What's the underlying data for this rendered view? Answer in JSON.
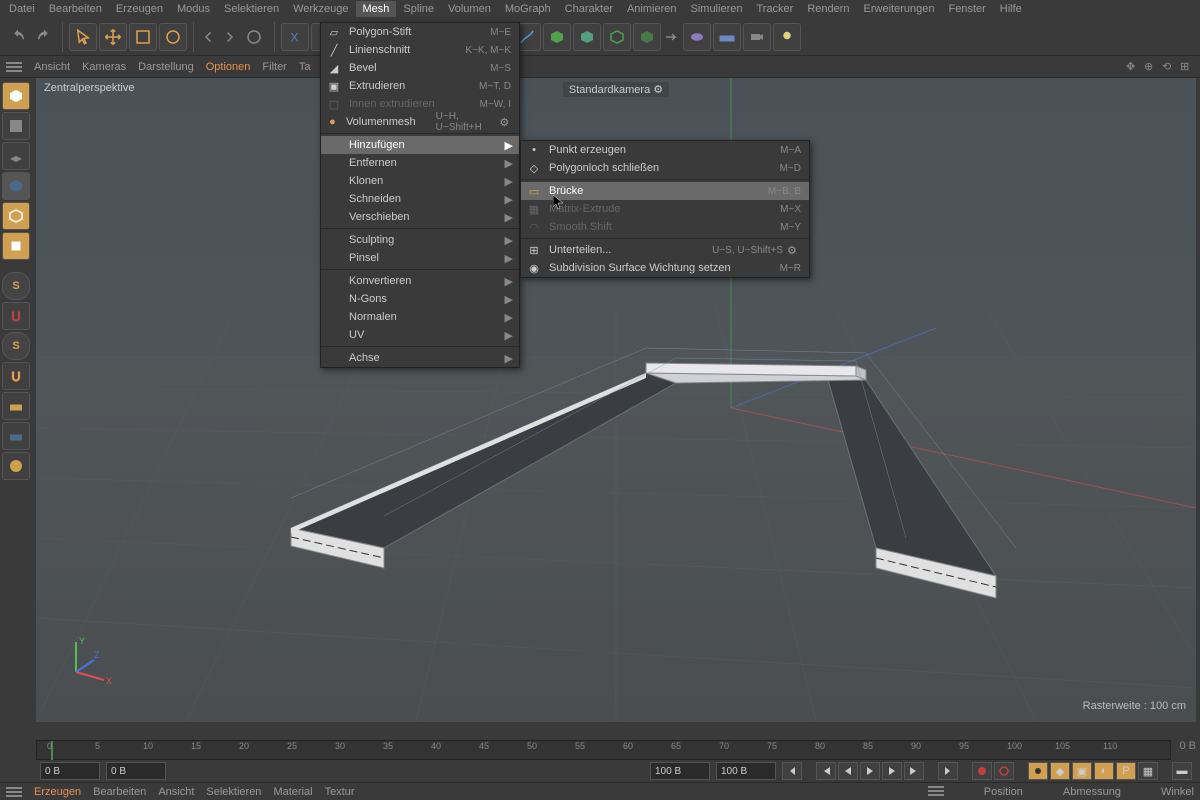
{
  "menubar": {
    "items": [
      "Datei",
      "Bearbeiten",
      "Erzeugen",
      "Modus",
      "Selektieren",
      "Werkzeuge",
      "Mesh",
      "Spline",
      "Volumen",
      "MoGraph",
      "Charakter",
      "Animieren",
      "Simulieren",
      "Tracker",
      "Rendern",
      "Erweiterungen",
      "Fenster",
      "Hilfe"
    ],
    "active_index": 6
  },
  "viewport_header": {
    "items": [
      "Ansicht",
      "Kameras",
      "Darstellung",
      "Optionen",
      "Filter",
      "Ta"
    ],
    "active_index": 3
  },
  "viewport": {
    "label": "Zentralperspektive",
    "camera": "Standardkamera",
    "grid_info": "Rasterweite : 100 cm"
  },
  "mesh_menu": {
    "items": [
      {
        "label": "Polygon-Stift",
        "shortcut": "M~E",
        "icon": "polygon"
      },
      {
        "label": "Linienschnitt",
        "shortcut": "K~K, M~K",
        "icon": "line"
      },
      {
        "label": "Bevel",
        "shortcut": "M~S",
        "icon": "bevel"
      },
      {
        "label": "Extrudieren",
        "shortcut": "M~T, D",
        "icon": "extrude"
      },
      {
        "label": "Innen extrudieren",
        "shortcut": "M~W, I",
        "icon": "inner",
        "disabled": true
      },
      {
        "label": "Volumenmesh",
        "shortcut": "U~H, U~Shift+H",
        "icon": "volume",
        "gear": true
      }
    ],
    "sep1": true,
    "items2": [
      {
        "label": "Hinzufügen",
        "arrow": true,
        "highlighted": true
      },
      {
        "label": "Entfernen",
        "arrow": true
      },
      {
        "label": "Klonen",
        "arrow": true
      },
      {
        "label": "Schneiden",
        "arrow": true
      },
      {
        "label": "Verschieben",
        "arrow": true
      }
    ],
    "sep2": true,
    "items3": [
      {
        "label": "Sculpting",
        "arrow": true
      },
      {
        "label": "Pinsel",
        "arrow": true
      }
    ],
    "sep3": true,
    "items4": [
      {
        "label": "Konvertieren",
        "arrow": true
      },
      {
        "label": "N-Gons",
        "arrow": true
      },
      {
        "label": "Normalen",
        "arrow": true
      },
      {
        "label": "UV",
        "arrow": true
      }
    ],
    "sep4": true,
    "items5": [
      {
        "label": "Achse",
        "arrow": true
      }
    ]
  },
  "submenu": {
    "items": [
      {
        "label": "Punkt erzeugen",
        "shortcut": "M~A",
        "icon": "point"
      },
      {
        "label": "Polygonloch schließen",
        "shortcut": "M~D",
        "icon": "hole"
      }
    ],
    "sep1": true,
    "items2": [
      {
        "label": "Brücke",
        "shortcut": "M~B, B",
        "icon": "bridge",
        "highlighted": true
      },
      {
        "label": "Matrix-Extrude",
        "shortcut": "M~X",
        "icon": "matrix",
        "disabled": true
      },
      {
        "label": "Smooth Shift",
        "shortcut": "M~Y",
        "icon": "smooth",
        "disabled": true
      }
    ],
    "sep2": true,
    "items3": [
      {
        "label": "Unterteilen...",
        "shortcut": "U~S, U~Shift+S",
        "icon": "subdivide",
        "gear": true
      },
      {
        "label": "Subdivision Surface Wichtung setzen",
        "shortcut": "M~R",
        "icon": "sds"
      }
    ]
  },
  "timeline": {
    "ticks": [
      0,
      5,
      10,
      15,
      20,
      25,
      30,
      35,
      40,
      45,
      50,
      55,
      60,
      65,
      70,
      75,
      80,
      85,
      90,
      95,
      100,
      105,
      110
    ],
    "frame_start": "0 B",
    "frame_current": "0 B",
    "frame_end": "100 B",
    "frame_end2": "100 B",
    "end_label": "0 B"
  },
  "statusbar": {
    "items": [
      "Erzeugen",
      "Bearbeiten",
      "Ansicht",
      "Selektieren",
      "Material",
      "Textur"
    ],
    "right": [
      "Position",
      "Abmessung",
      "Winkel"
    ]
  },
  "axis": {
    "x": "X",
    "y": "Y",
    "z": "Z"
  }
}
